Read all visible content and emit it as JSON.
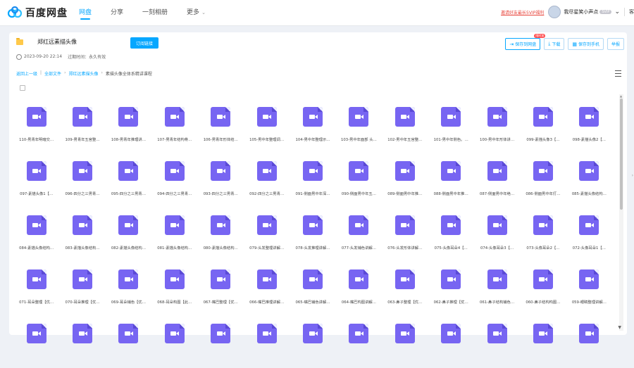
{
  "app": {
    "name": "百度网盘"
  },
  "nav": {
    "items": [
      "网盘",
      "分享",
      "一刻相册",
      "更多"
    ],
    "active_index": 0
  },
  "account": {
    "promo": "邀请好友最长5VIP福利",
    "username": "我尽星笑小声点",
    "vip": "SVIP",
    "more": "客"
  },
  "share": {
    "title": "郑红远素描头像",
    "subscribe": "订阅链接",
    "date": "2023-09-20 22:14",
    "expire": "过期时间：永久有效"
  },
  "actions": {
    "save": "保存到网盘",
    "save_badge": "限时加",
    "download": "下载",
    "save_phone": "保存到手机",
    "report": "举报"
  },
  "breadcrumb": [
    "返回上一级",
    "全部文件",
    "郑红远素描头像",
    "素描头像全体系精讲课程"
  ],
  "accent_color": "#06a7ff",
  "file_icon": "video-file-icon",
  "files": [
    "110-男青年明暗交…",
    "109-男青年五官整…",
    "108-男青年推理讲…",
    "107-男青年结构骨…",
    "106-男青年形体结…",
    "105-男中年整理调…",
    "104-男中年整理示…",
    "103-男中年面部 头…",
    "102-男中年五官整…",
    "101-男中年侧色。…",
    "100-男中年形体讲…",
    "099-素描头像3【…",
    "098-素描头像2【…",
    "097-素描头像1【…",
    "096-四分之三男青…",
    "095-四分之三男青…",
    "094-四分之三男青…",
    "093-四分之三男青…",
    "092-四分之三男青…",
    "091-侧面男中年深…",
    "090-侧面男中年五…",
    "089-侧面男中年推…",
    "088-侧面男中年推…",
    "087-侧面男中年绝…",
    "086-侧面男中年打…",
    "085-素描头像结构…",
    "084-素描头像结构…",
    "083-素描头像结构…",
    "082-素描头像结构…",
    "081-素描头像结构…",
    "080-素描头像结构…",
    "079-头发整理讲解…",
    "078-头发推理讲解…",
    "077-头发铺色讲解…",
    "076-头发形体讲解…",
    "075-头像耳朵4【…",
    "074-头像耳朵3【…",
    "073-头像耳朵2【…",
    "072-头像耳朵1【…",
    "071-耳朵整理【优…",
    "070-耳朵推理【优…",
    "069-耳朵铺色【优…",
    "068-耳朵构图【此…",
    "067-嘴巴整理【优…",
    "066-嘴巴推理讲解…",
    "065-嘴巴铺色讲解…",
    "064-嘴巴构图讲解…",
    "063-鼻子整理【优…",
    "062-鼻子推理【优…",
    "061-鼻子结构铺色…",
    "060-鼻子结构构图…",
    "059-眼睛整理讲解…",
    "",
    "",
    "",
    "",
    "",
    "",
    "",
    "",
    "",
    "",
    "",
    "",
    ""
  ]
}
